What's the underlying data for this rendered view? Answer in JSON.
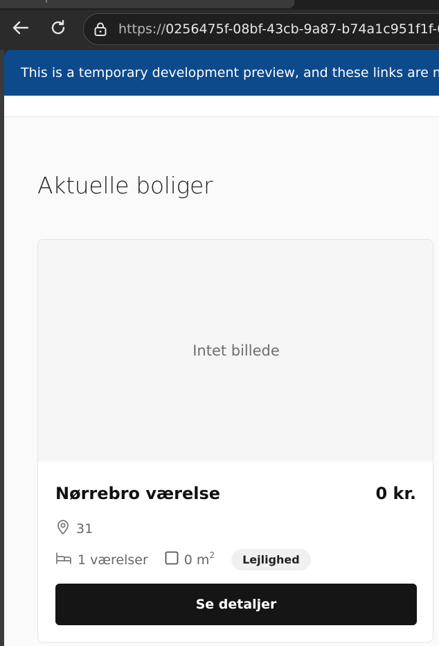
{
  "browser": {
    "url_scheme": "https://",
    "url_rest": "0256475f-08bf-43cb-9a87-b74a1c951f1f-0",
    "icons": {
      "back": "back-arrow-icon",
      "reload": "reload-icon",
      "lock": "lock-icon"
    }
  },
  "banner": {
    "text": "This is a temporary development preview, and these links are not",
    "color": "#0d4a8c"
  },
  "page": {
    "title": "Aktuelle boliger"
  },
  "listing": {
    "image_placeholder": "Intet billede",
    "title": "Nørrebro værelse",
    "price": "0 kr.",
    "location": "31",
    "rooms": "1 værelser",
    "area_value": "0 m",
    "area_unit_sup": "2",
    "type_badge": "Lejlighed",
    "cta_label": "Se detaljer",
    "icons": {
      "location": "map-pin-icon",
      "rooms": "bed-icon",
      "area": "square-icon"
    }
  }
}
